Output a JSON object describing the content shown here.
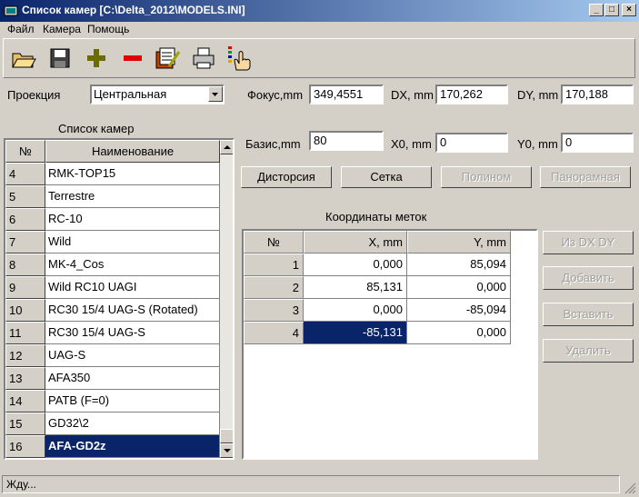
{
  "window": {
    "title": "Список камер [C:\\Delta_2012\\MODELS.INI]"
  },
  "menu": [
    "Файл",
    "Камера",
    "Помощь"
  ],
  "toolbar": [
    "open-icon",
    "save-icon",
    "add-icon",
    "remove-icon",
    "edit-notes-icon",
    "print-icon",
    "select-hand-icon"
  ],
  "projection": {
    "label": "Проекция",
    "value": "Центральная"
  },
  "focus": {
    "label": "Фокус,mm",
    "value": "349,4551"
  },
  "dx": {
    "label": "DX, mm",
    "value": "170,262"
  },
  "dy": {
    "label": "DY, mm",
    "value": "170,188"
  },
  "base": {
    "label": "Базис,mm",
    "value": "80"
  },
  "x0": {
    "label": "X0, mm",
    "value": "0"
  },
  "y0": {
    "label": "Y0, mm",
    "value": "0"
  },
  "buttons": {
    "distortion": "Дисторсия",
    "grid": "Сетка",
    "polynomial": "Полином",
    "panoramic": "Панорамная",
    "from_dxdy": "Из DX DY",
    "add": "Добавить",
    "insert": "Вставить",
    "delete": "Удалить"
  },
  "camera_list": {
    "title": "Список камер",
    "headers": [
      "№",
      "Наименование"
    ],
    "rows": [
      [
        "4",
        "RMK-TOP15"
      ],
      [
        "5",
        "Terrestre"
      ],
      [
        "6",
        "RC-10"
      ],
      [
        "7",
        "Wild"
      ],
      [
        "8",
        "MK-4_Cos"
      ],
      [
        "9",
        "Wild RC10 UAGI"
      ],
      [
        "10",
        "RC30 15/4 UAG-S (Rotated)"
      ],
      [
        "11",
        "RC30 15/4 UAG-S"
      ],
      [
        "12",
        "UAG-S"
      ],
      [
        "13",
        "AFA350"
      ],
      [
        "14",
        "PATB (F=0)"
      ],
      [
        "15",
        "GD32\\2"
      ],
      [
        "16",
        "AFA-GD2z"
      ]
    ],
    "selected": "16"
  },
  "marks": {
    "title": "Координаты меток",
    "headers": [
      "№",
      "X, mm",
      "Y, mm"
    ],
    "rows": [
      [
        "1",
        "0,000",
        "85,094"
      ],
      [
        "2",
        "85,131",
        "0,000"
      ],
      [
        "3",
        "0,000",
        "-85,094"
      ],
      [
        "4",
        "-85,131",
        "0,000"
      ]
    ]
  },
  "status": "Жду..."
}
